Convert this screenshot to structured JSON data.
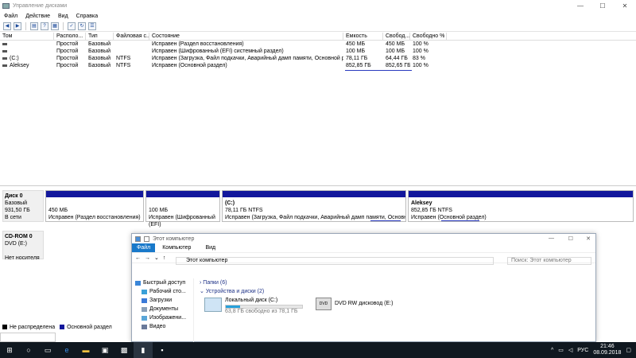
{
  "window": {
    "title": "Управление дисками",
    "minimize": "—",
    "maximize": "☐",
    "close": "✕"
  },
  "menu": [
    "Файл",
    "Действие",
    "Вид",
    "Справка"
  ],
  "table": {
    "columns": [
      "Том",
      "Располо...",
      "Тип",
      "Файловая с...",
      "Состояние",
      "Емкость",
      "Свобод...",
      "Свободно %"
    ],
    "rows": [
      [
        "",
        "Простой",
        "Базовый",
        "",
        "Исправен (Раздел восстановления)",
        "450 МБ",
        "450 МБ",
        "100 %"
      ],
      [
        "",
        "Простой",
        "Базовый",
        "",
        "Исправен (Шифрованный (EFI) системный раздел)",
        "100 МБ",
        "100 МБ",
        "100 %"
      ],
      [
        "(C:)",
        "Простой",
        "Базовый",
        "NTFS",
        "Исправен (Загрузка, Файл подкачки, Аварийный дамп памяти, Основной раздел)",
        "78,11 ГБ",
        "64,44 ГБ",
        "83 %"
      ],
      [
        "Aleksey",
        "Простой",
        "Базовый",
        "NTFS",
        "Исправен (Основной раздел)",
        "852,85 ГБ",
        "852,65 ГБ",
        "100 %"
      ]
    ]
  },
  "disk0": {
    "label": [
      "Диск 0",
      "Базовый",
      "931,50 ГБ",
      "В сети"
    ],
    "partitions": [
      {
        "name": "",
        "size": "450 МБ",
        "status": "Исправен (Раздел восстановления)"
      },
      {
        "name": "",
        "size": "100 МБ",
        "status": "Исправен (Шифрованный (EFI)"
      },
      {
        "name": "(C:)",
        "size": "78,11 ГБ NTFS",
        "status": "Исправен (Загрузка, Файл подкачки, Аварийный дамп памяти, Основной разд"
      },
      {
        "name": "Aleksey",
        "size": "852,85 ГБ NTFS",
        "status": "Исправен (Основной раздел)"
      }
    ]
  },
  "cdrom": {
    "label": [
      "CD-ROM 0",
      "DVD (E:)",
      "",
      "Нет носителя"
    ]
  },
  "legend": {
    "unallocated": "Не распределена",
    "primary": "Основной раздел"
  },
  "explorer": {
    "title": "Этот компьютер",
    "tabs": [
      "Файл",
      "Компьютер",
      "Вид"
    ],
    "address": "Этот компьютер",
    "search_placeholder": "Поиск: Этот компьютер",
    "nav": [
      "Быстрый доступ",
      "Рабочий сто...",
      "Загрузки",
      "Документы",
      "Изображени...",
      "Видео"
    ],
    "groups": {
      "folders": "Папки (6)",
      "devices": "Устройства и диски (2)"
    },
    "local_disk": {
      "name": "Локальный диск (C:)",
      "free": "63,8 ГБ свободно из 78,1 ГБ",
      "used_fraction": 0.183
    },
    "dvd": {
      "name": "DVD RW дисковод (E:)",
      "badge": "DVD"
    }
  },
  "taskbar": {
    "lang": "РУС",
    "time": "21:46",
    "date": "08.09.2018"
  },
  "colors": {
    "primary": "#12179c",
    "unallocated": "#000000",
    "annotation": "#2a3bbf",
    "file_tab": "#1979ca"
  }
}
